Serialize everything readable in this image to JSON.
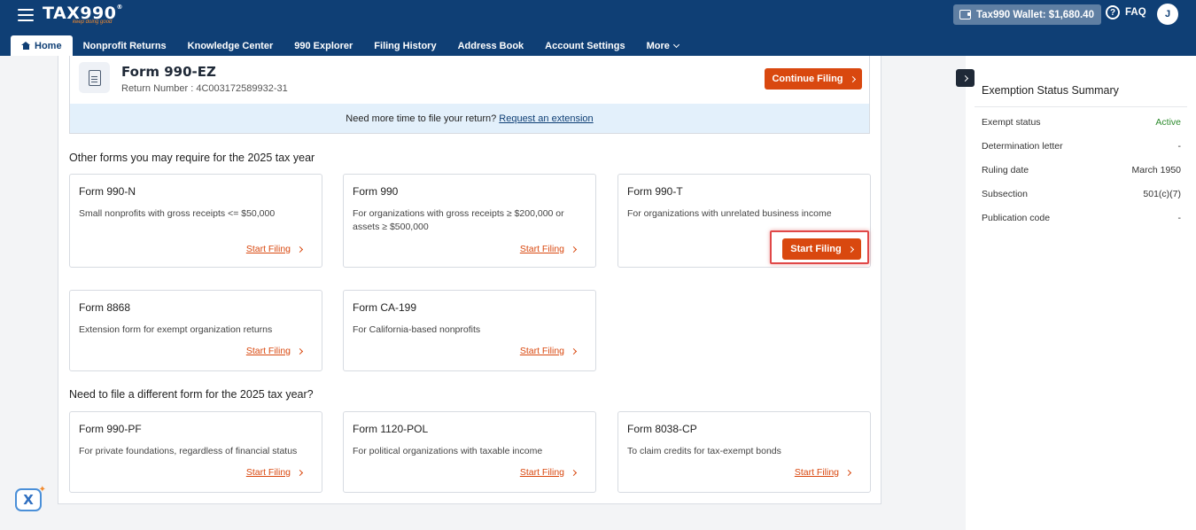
{
  "header": {
    "logo": "TAX990",
    "tagline": "keep doing good",
    "wallet_label": "Tax990 Wallet: $1,680.40",
    "faq_label": "FAQ",
    "avatar_initial": "J"
  },
  "nav": {
    "items": [
      "Home",
      "Nonprofit Returns",
      "Knowledge Center",
      "990 Explorer",
      "Filing History",
      "Address Book",
      "Account Settings",
      "More"
    ]
  },
  "current_return": {
    "title": "Form 990-EZ",
    "return_number": "Return Number : 4C003172589932-31",
    "continue_label": "Continue Filing",
    "extension_text": "Need more time to file your return?",
    "extension_link": "Request an extension"
  },
  "sections": {
    "other_forms_title": "Other forms you may require for the 2025 tax year",
    "different_forms_title": "Need to file a different form for the 2025 tax year?"
  },
  "forms": [
    {
      "title": "Form 990-N",
      "desc": "Small nonprofits with gross receipts <= $50,000",
      "action": "Start Filing"
    },
    {
      "title": "Form 990",
      "desc": "For organizations with gross receipts ≥ $200,000 or assets ≥ $500,000",
      "action": "Start Filing"
    },
    {
      "title": "Form 990-T",
      "desc": "For organizations with unrelated business income",
      "action": "Start Filing"
    },
    {
      "title": "Form 8868",
      "desc": "Extension form for exempt organization returns",
      "action": "Start Filing"
    },
    {
      "title": "Form CA-199",
      "desc": "For California-based nonprofits",
      "action": "Start Filing"
    },
    {
      "title": "Form 990-PF",
      "desc": "For private foundations, regardless of financial status",
      "action": "Start Filing"
    },
    {
      "title": "Form 1120-POL",
      "desc": "For political organizations with taxable income",
      "action": "Start Filing"
    },
    {
      "title": "Form 8038-CP",
      "desc": "To claim credits for tax-exempt bonds",
      "action": "Start Filing"
    }
  ],
  "summary": {
    "title": "Exemption Status Summary",
    "rows": [
      {
        "label": "Exempt status",
        "value": "Active"
      },
      {
        "label": "Determination letter",
        "value": "-"
      },
      {
        "label": "Ruling date",
        "value": "March 1950"
      },
      {
        "label": "Subsection",
        "value": "501(c)(7)"
      },
      {
        "label": "Publication code",
        "value": "-"
      }
    ]
  },
  "colors": {
    "header_bg": "#0f3f75",
    "accent": "#d9480f",
    "active_status": "#2e8b2e",
    "extension_bg": "#e3f0fb"
  }
}
